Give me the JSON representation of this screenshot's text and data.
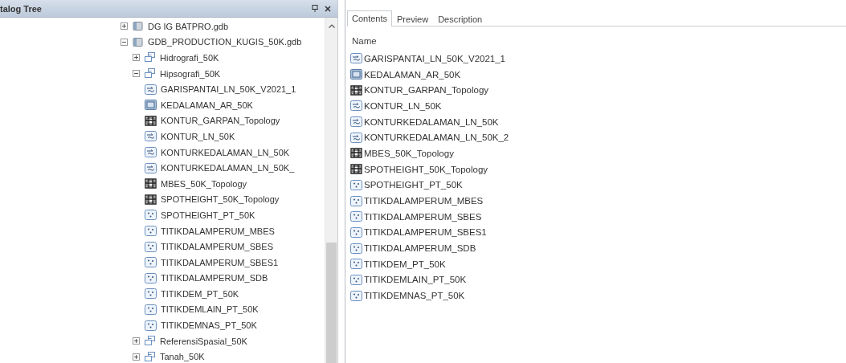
{
  "catalog_tree": {
    "title": "talog Tree",
    "nodes": [
      {
        "label": "DG IG BATPRO.gdb",
        "kind": "gdb",
        "expanded": false
      },
      {
        "label": "GDB_PRODUCTION_KUGIS_50K.gdb",
        "kind": "gdb",
        "expanded": true,
        "children": [
          {
            "label": "Hidrografi_50K",
            "kind": "dataset",
            "expanded": false
          },
          {
            "label": "Hipsografi_50K",
            "kind": "dataset",
            "expanded": true,
            "children": [
              {
                "label": "GARISPANTAI_LN_50K_V2021_1",
                "kind": "line"
              },
              {
                "label": "KEDALAMAN_AR_50K",
                "kind": "polygon"
              },
              {
                "label": "KONTUR_GARPAN_Topology",
                "kind": "topology"
              },
              {
                "label": "KONTUR_LN_50K",
                "kind": "line"
              },
              {
                "label": "KONTURKEDALAMAN_LN_50K",
                "kind": "line"
              },
              {
                "label": "KONTURKEDALAMAN_LN_50K_",
                "kind": "line"
              },
              {
                "label": "MBES_50K_Topology",
                "kind": "topology"
              },
              {
                "label": "SPOTHEIGHT_50K_Topology",
                "kind": "topology"
              },
              {
                "label": "SPOTHEIGHT_PT_50K",
                "kind": "point"
              },
              {
                "label": "TITIKDALAMPERUM_MBES",
                "kind": "point"
              },
              {
                "label": "TITIKDALAMPERUM_SBES",
                "kind": "point"
              },
              {
                "label": "TITIKDALAMPERUM_SBES1",
                "kind": "point"
              },
              {
                "label": "TITIKDALAMPERUM_SDB",
                "kind": "point"
              },
              {
                "label": "TITIKDEM_PT_50K",
                "kind": "point"
              },
              {
                "label": "TITIKDEMLAIN_PT_50K",
                "kind": "point"
              },
              {
                "label": "TITIKDEMNAS_PT_50K",
                "kind": "point"
              }
            ]
          },
          {
            "label": "ReferensiSpasial_50K",
            "kind": "dataset",
            "expanded": false
          },
          {
            "label": "Tanah_50K",
            "kind": "dataset",
            "expanded": false
          }
        ]
      }
    ]
  },
  "contents": {
    "tabs": [
      {
        "label": "Contents",
        "selected": true
      },
      {
        "label": "Preview",
        "selected": false
      },
      {
        "label": "Description",
        "selected": false
      }
    ],
    "column": "Name",
    "items": [
      {
        "label": "GARISPANTAI_LN_50K_V2021_1",
        "kind": "line"
      },
      {
        "label": "KEDALAMAN_AR_50K",
        "kind": "polygon"
      },
      {
        "label": "KONTUR_GARPAN_Topology",
        "kind": "topology"
      },
      {
        "label": "KONTUR_LN_50K",
        "kind": "line"
      },
      {
        "label": "KONTURKEDALAMAN_LN_50K",
        "kind": "line"
      },
      {
        "label": "KONTURKEDALAMAN_LN_50K_2",
        "kind": "line"
      },
      {
        "label": "MBES_50K_Topology",
        "kind": "topology"
      },
      {
        "label": "SPOTHEIGHT_50K_Topology",
        "kind": "topology"
      },
      {
        "label": "SPOTHEIGHT_PT_50K",
        "kind": "point"
      },
      {
        "label": "TITIKDALAMPERUM_MBES",
        "kind": "point"
      },
      {
        "label": "TITIKDALAMPERUM_SBES",
        "kind": "point"
      },
      {
        "label": "TITIKDALAMPERUM_SBES1",
        "kind": "point"
      },
      {
        "label": "TITIKDALAMPERUM_SDB",
        "kind": "point"
      },
      {
        "label": "TITIKDEM_PT_50K",
        "kind": "point"
      },
      {
        "label": "TITIKDEMLAIN_PT_50K",
        "kind": "point"
      },
      {
        "label": "TITIKDEMNAS_PT_50K",
        "kind": "point"
      }
    ]
  }
}
